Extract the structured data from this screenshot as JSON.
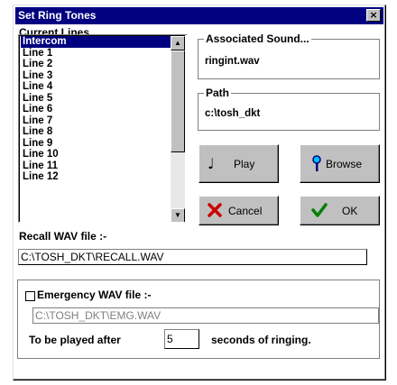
{
  "window": {
    "title": "Set Ring Tones",
    "close_label": "×"
  },
  "lines": {
    "label": "Current Lines...",
    "items": [
      "Intercom",
      "Line 1",
      "Line 2",
      "Line 3",
      "Line 4",
      "Line 5",
      "Line 6",
      "Line 7",
      "Line 8",
      "Line 9",
      "Line 10",
      "Line 11",
      "Line 12"
    ],
    "selected": "Intercom"
  },
  "associated_sound": {
    "label": "Associated Sound...",
    "value": "ringint.wav"
  },
  "path": {
    "label": "Path",
    "value": "c:\\tosh_dkt"
  },
  "buttons": {
    "play": "Play",
    "browse": "Browse",
    "cancel": "Cancel",
    "ok": "OK"
  },
  "recall": {
    "label": "Recall WAV file :-",
    "value": "C:\\TOSH_DKT\\RECALL.WAV"
  },
  "emergency": {
    "label": "Emergency WAV file :-",
    "checked": false,
    "value": "C:\\TOSH_DKT\\EMG.WAV",
    "delay_prefix": "To be played after",
    "delay_value": "5",
    "delay_suffix": "seconds of ringing."
  },
  "colors": {
    "title_bar": "#000080",
    "selection": "#000080",
    "dialog_bg": "#ffffff",
    "button_face": "#c0c0c0"
  }
}
